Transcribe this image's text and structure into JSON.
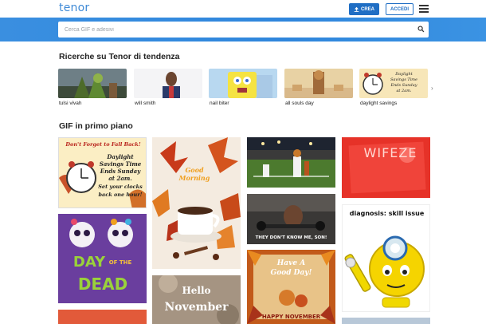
{
  "header": {
    "logo": "tenor",
    "create_label": "CREA",
    "login_label": "ACCEDI",
    "menu_icon": "hamburger-menu-icon"
  },
  "search": {
    "placeholder": "Cerca GIF e adesivi",
    "icon": "search-icon"
  },
  "trending": {
    "title": "Ricerche su Tenor di tendenza",
    "items": [
      {
        "label": "tulsi vivah"
      },
      {
        "label": "will smith"
      },
      {
        "label": "nail biter"
      },
      {
        "label": "all souls day"
      },
      {
        "label": "daylight savings"
      }
    ],
    "next_icon": "chevron-right-icon"
  },
  "featured": {
    "title": "GIF in primo piano",
    "captions": {
      "dst_lines": [
        "Don't Forget to Fall Back!",
        "Daylight",
        "Savings Time",
        "Ends Sunday",
        "at 2am.",
        "Set your clocks",
        "back one hour!"
      ],
      "fuze": "WIFEZE",
      "son": "THEY DON'T KNOW ME, SON!",
      "skill": "diagnosis: skill issue",
      "good_day": [
        "Have A",
        "Good Day!"
      ],
      "happy_nov": "HAPPY NOVEMBER",
      "dotd": [
        "DAY",
        "OF THE",
        "DEAD"
      ],
      "hello_nov": [
        "Hello",
        "November"
      ],
      "good_morning": [
        "Good",
        "Morning"
      ]
    }
  }
}
